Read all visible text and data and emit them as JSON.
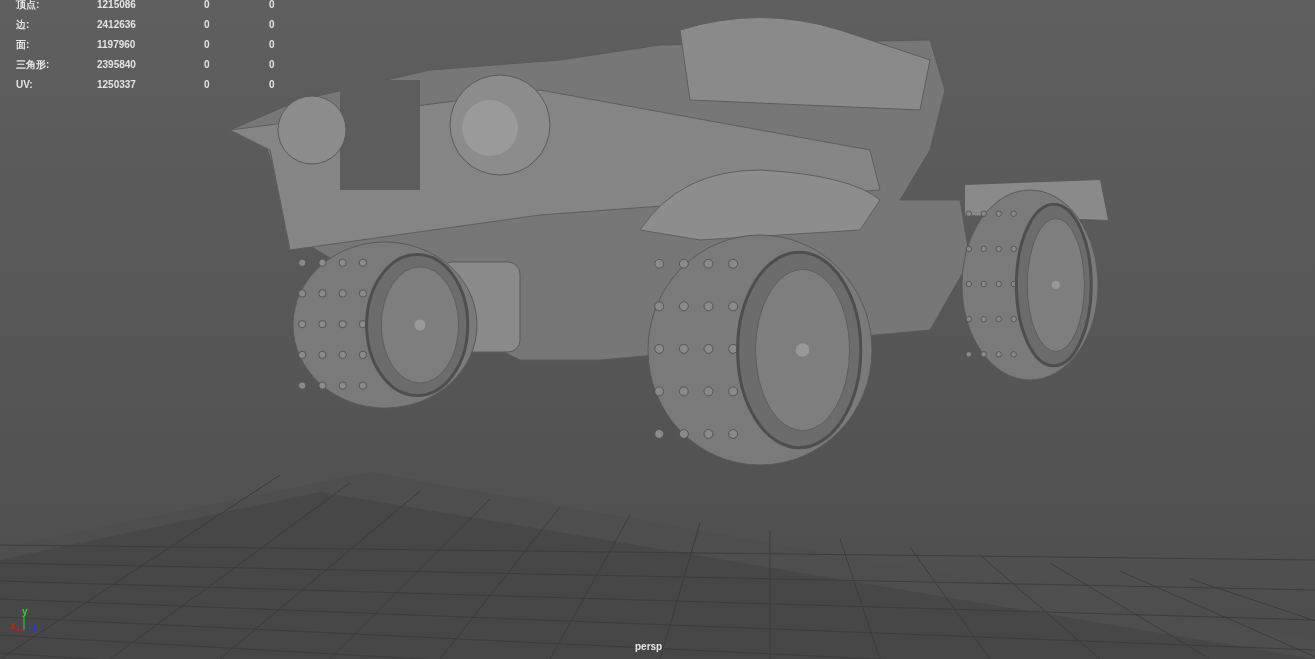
{
  "hud": {
    "rows": [
      {
        "label": "顶点:",
        "values": [
          "1215086",
          "0",
          "0"
        ]
      },
      {
        "label": "边:",
        "values": [
          "2412636",
          "0",
          "0"
        ]
      },
      {
        "label": "面:",
        "values": [
          "1197960",
          "0",
          "0"
        ]
      },
      {
        "label": "三角形:",
        "values": [
          "2395840",
          "0",
          "0"
        ]
      },
      {
        "label": "UV:",
        "values": [
          "1250337",
          "0",
          "0"
        ]
      }
    ]
  },
  "axes": [
    {
      "label": "y",
      "color": "#22dd22"
    },
    {
      "label": "x",
      "color": "#ee1111"
    },
    {
      "label": "z",
      "color": "#2233ff"
    }
  ],
  "camera": "persp"
}
